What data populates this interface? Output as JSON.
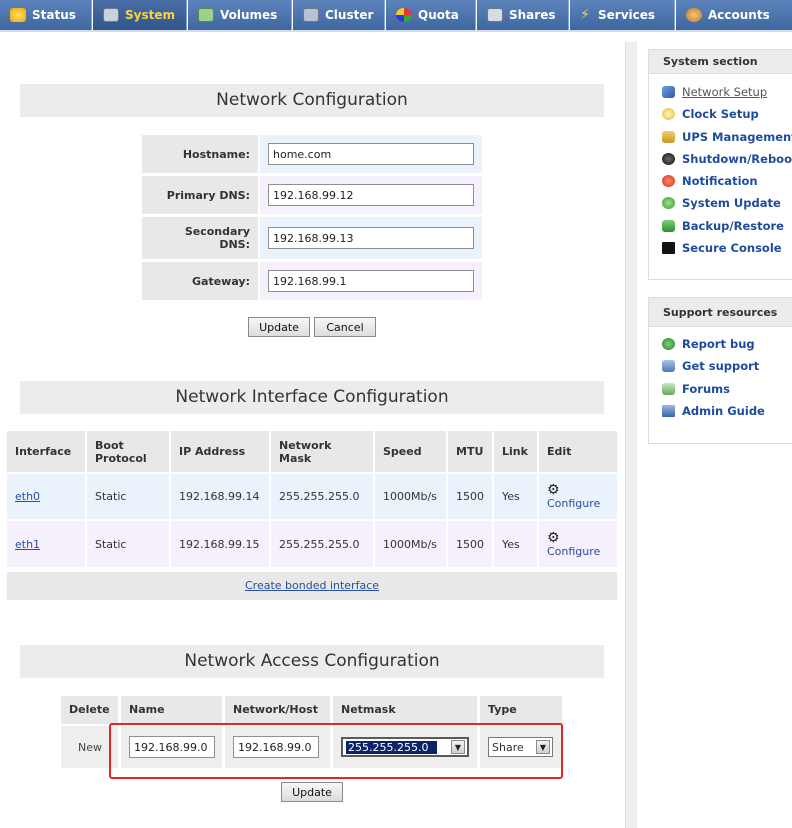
{
  "tabs": [
    {
      "label": "Status",
      "icon": "sun-icon",
      "active": false
    },
    {
      "label": "System",
      "icon": "computer-icon",
      "active": true
    },
    {
      "label": "Volumes",
      "icon": "disk-icon",
      "active": false
    },
    {
      "label": "Cluster",
      "icon": "cluster-icon",
      "active": false
    },
    {
      "label": "Quota",
      "icon": "quota-icon",
      "active": false
    },
    {
      "label": "Shares",
      "icon": "shares-icon",
      "active": false
    },
    {
      "label": "Services",
      "icon": "lightning-icon",
      "active": false
    },
    {
      "label": "Accounts",
      "icon": "users-icon",
      "active": false
    }
  ],
  "network_config": {
    "title": "Network Configuration",
    "hostname_label": "Hostname:",
    "hostname_value": "home.com",
    "primary_dns_label": "Primary DNS:",
    "primary_dns_value": "192.168.99.12",
    "secondary_dns_label": "Secondary DNS:",
    "secondary_dns_value": "192.168.99.13",
    "gateway_label": "Gateway:",
    "gateway_value": "192.168.99.1",
    "update_label": "Update",
    "cancel_label": "Cancel"
  },
  "interface_config": {
    "title": "Network Interface Configuration",
    "headers": [
      "Interface",
      "Boot Protocol",
      "IP Address",
      "Network Mask",
      "Speed",
      "MTU",
      "Link",
      "Edit"
    ],
    "rows": [
      {
        "interface": "eth0",
        "protocol": "Static",
        "ip": "192.168.99.14",
        "mask": "255.255.255.0",
        "speed": "1000Mb/s",
        "mtu": "1500",
        "link": "Yes",
        "edit": "Configure"
      },
      {
        "interface": "eth1",
        "protocol": "Static",
        "ip": "192.168.99.15",
        "mask": "255.255.255.0",
        "speed": "1000Mb/s",
        "mtu": "1500",
        "link": "Yes",
        "edit": "Configure"
      }
    ],
    "bond_link": "Create bonded interface"
  },
  "access_config": {
    "title": "Network Access Configuration",
    "headers": {
      "delete": "Delete",
      "name": "Name",
      "network": "Network/Host",
      "netmask": "Netmask",
      "type": "Type"
    },
    "row_label": "New",
    "name_value": "192.168.99.0",
    "network_value": "192.168.99.0",
    "netmask_value": "255.255.255.0",
    "type_value": "Share",
    "update_label": "Update",
    "highlight_color": "#e22525"
  },
  "sidebar": {
    "system_title": "System section",
    "system_items": [
      {
        "label": "Network Setup",
        "icon": "network-icon",
        "current": true
      },
      {
        "label": "Clock Setup",
        "icon": "clock-icon",
        "current": false
      },
      {
        "label": "UPS Management",
        "icon": "ups-icon",
        "current": false
      },
      {
        "label": "Shutdown/Reboot",
        "icon": "shutdown-icon",
        "current": false
      },
      {
        "label": "Notification",
        "icon": "alert-icon",
        "current": false
      },
      {
        "label": "System Update",
        "icon": "update-icon",
        "current": false
      },
      {
        "label": "Backup/Restore",
        "icon": "backup-icon",
        "current": false
      },
      {
        "label": "Secure Console",
        "icon": "console-icon",
        "current": false
      }
    ],
    "support_title": "Support resources",
    "support_items": [
      {
        "label": "Report bug",
        "icon": "bug-icon"
      },
      {
        "label": "Get support",
        "icon": "support-icon"
      },
      {
        "label": "Forums",
        "icon": "forums-icon"
      },
      {
        "label": "Admin Guide",
        "icon": "book-icon"
      }
    ]
  },
  "colors": {
    "tab_bar": "#4a6fa8",
    "active_tab_text": "#ffd23a",
    "link": "#2a4ea0"
  }
}
